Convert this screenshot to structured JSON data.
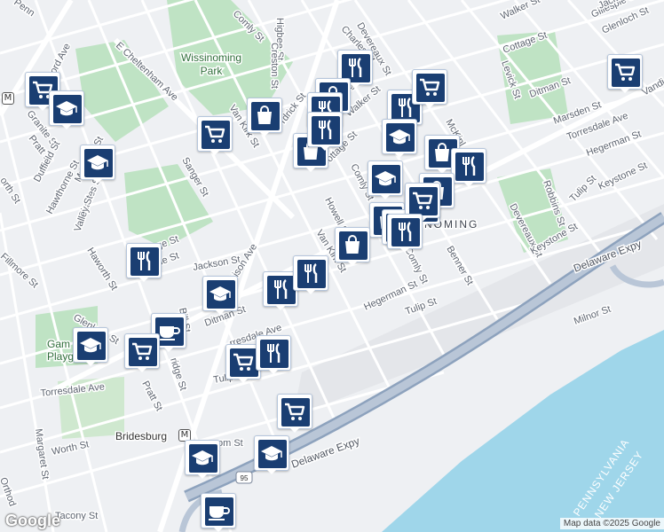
{
  "map": {
    "streets": [
      {
        "id": "penn",
        "text": "Penn"
      },
      {
        "id": "comly-top",
        "text": "Comly St"
      },
      {
        "id": "higbee",
        "text": "Higbee St"
      },
      {
        "id": "creston",
        "text": "Creston St"
      },
      {
        "id": "charles-top",
        "text": "Charles St"
      },
      {
        "id": "devereaux-top",
        "text": "Devereaux St"
      },
      {
        "id": "walker-top",
        "text": "Walker St"
      },
      {
        "id": "gillespie-right",
        "text": "Gillespie St"
      },
      {
        "id": "jackson-right",
        "text": "Jackson St"
      },
      {
        "id": "glenloch-right",
        "text": "Glenloch St"
      },
      {
        "id": "cottage-right",
        "text": "Cottage St"
      },
      {
        "id": "ditman-right",
        "text": "Ditman St"
      },
      {
        "id": "marsden-right",
        "text": "Marsden St"
      },
      {
        "id": "torresdale-right",
        "text": "Torresdale Ave"
      },
      {
        "id": "vandike",
        "text": "Vandi"
      },
      {
        "id": "hegerman-right",
        "text": "Hegerman St"
      },
      {
        "id": "levick",
        "text": "Levick St"
      },
      {
        "id": "ord-ave",
        "text": "ord Ave"
      },
      {
        "id": "e-cheltenham",
        "text": "E Cheltenham Ave"
      },
      {
        "id": "van-kirk-top",
        "text": "Van Kirk St"
      },
      {
        "id": "dittrick",
        "text": "rdrick St"
      },
      {
        "id": "montague",
        "text": "ontague St"
      },
      {
        "id": "walker-mid",
        "text": "Walker St"
      },
      {
        "id": "mckinley",
        "text": "McKinl"
      },
      {
        "id": "cottage-mid",
        "text": "Cottage St"
      },
      {
        "id": "comly-mid",
        "text": "Comly St"
      },
      {
        "id": "howell",
        "text": "Howell St"
      },
      {
        "id": "van-kirk-mid",
        "text": "Van Kirk St"
      },
      {
        "id": "devereaux-right",
        "text": "Devereaux St"
      },
      {
        "id": "robbins",
        "text": "Robbins St"
      },
      {
        "id": "tulip-right",
        "text": "Tulip St"
      },
      {
        "id": "keystone-right",
        "text": "Keystone St"
      },
      {
        "id": "keystone-mid",
        "text": "Keystone St"
      },
      {
        "id": "benner",
        "text": "Benner St"
      },
      {
        "id": "comly-low",
        "text": "Comly St"
      },
      {
        "id": "hegerman-mid",
        "text": "Hegerman St"
      },
      {
        "id": "tulip-mid",
        "text": "Tulip St"
      },
      {
        "id": "granite",
        "text": "Granite St"
      },
      {
        "id": "pratt-left",
        "text": "Pratt St"
      },
      {
        "id": "duffield",
        "text": "Duffield St"
      },
      {
        "id": "hawthorne",
        "text": "Hawthorne St"
      },
      {
        "id": "sanger",
        "text": "Sanger St"
      },
      {
        "id": "orth",
        "text": "orth St"
      },
      {
        "id": "mulberry",
        "text": "Mulberry St"
      },
      {
        "id": "charles-left",
        "text": "Charles St"
      },
      {
        "id": "valley",
        "text": "Valley St"
      },
      {
        "id": "haworth",
        "text": "Haworth St"
      },
      {
        "id": "fillmore",
        "text": "Fillmore St"
      },
      {
        "id": "cottage-low",
        "text": "Cottage St"
      },
      {
        "id": "gillespie-low",
        "text": "Gillespie St"
      },
      {
        "id": "jackson-low",
        "text": "Jackson St"
      },
      {
        "id": "harbison",
        "text": "Harbison Ave"
      },
      {
        "id": "ditman-low",
        "text": "Ditman St"
      },
      {
        "id": "glenloch-low",
        "text": "Glenloch St"
      },
      {
        "id": "bill",
        "text": "Bill St"
      },
      {
        "id": "bridge",
        "text": "ridge St"
      },
      {
        "id": "torresdale-mid",
        "text": "rresdale Ave"
      },
      {
        "id": "tulip-low",
        "text": "Tulip"
      },
      {
        "id": "torresdale-left",
        "text": "Torresdale Ave"
      },
      {
        "id": "pratt-low",
        "text": "Pratt St"
      },
      {
        "id": "margaret",
        "text": "Margaret St"
      },
      {
        "id": "worth",
        "text": "Worth St"
      },
      {
        "id": "orthodox",
        "text": "Orthod"
      },
      {
        "id": "tacony",
        "text": "Tacony St"
      },
      {
        "id": "om-st",
        "text": "om St"
      },
      {
        "id": "milnor",
        "text": "Milnor St"
      }
    ],
    "parks": [
      {
        "id": "wissinoming-park",
        "line1": "Wissinoming",
        "line2": "Park"
      },
      {
        "id": "gambrel",
        "line1": "Gam",
        "line2": "Playgr"
      }
    ],
    "highways": [
      {
        "id": "delaware-top",
        "text": "Delaware Expy"
      },
      {
        "id": "delaware-bottom",
        "text": "Delaware Expy"
      }
    ],
    "route_shield": "95",
    "neighborhood_label": "NOMING",
    "place_labels": [
      {
        "id": "bridesburg",
        "text": "Bridesburg"
      }
    ],
    "state_labels": [
      {
        "id": "pennsylvania",
        "text": "PENNSYLVANIA"
      },
      {
        "id": "new-jersey",
        "text": "NEW JERSEY"
      }
    ],
    "markers": [
      {
        "icon": "cart"
      },
      {
        "icon": "school"
      },
      {
        "icon": "school"
      },
      {
        "icon": "cart"
      },
      {
        "icon": "bag"
      },
      {
        "icon": "bag"
      },
      {
        "icon": "cutlery"
      },
      {
        "icon": "bag"
      },
      {
        "icon": "cutlery"
      },
      {
        "icon": "cutlery"
      },
      {
        "icon": "cart"
      },
      {
        "icon": "cutlery"
      },
      {
        "icon": "school"
      },
      {
        "icon": "bag"
      },
      {
        "icon": "cutlery"
      },
      {
        "icon": "school"
      },
      {
        "icon": "bag"
      },
      {
        "icon": "cutlery"
      },
      {
        "icon": "bag"
      },
      {
        "icon": "bag"
      },
      {
        "icon": "bag"
      },
      {
        "icon": "cutlery"
      },
      {
        "icon": "cutlery"
      },
      {
        "icon": "cutlery"
      },
      {
        "icon": "school"
      },
      {
        "icon": "cup"
      },
      {
        "icon": "school"
      },
      {
        "icon": "cart"
      },
      {
        "icon": "cart"
      },
      {
        "icon": "cutlery"
      },
      {
        "icon": "cart"
      },
      {
        "icon": "school"
      },
      {
        "icon": "school"
      },
      {
        "icon": "cup"
      },
      {
        "icon": "cart"
      },
      {
        "icon": "cart"
      },
      {
        "icon": "cutlery"
      }
    ],
    "attribution": "Map data ©2025 Google",
    "logo": "Google",
    "transit_symbol": "M"
  }
}
